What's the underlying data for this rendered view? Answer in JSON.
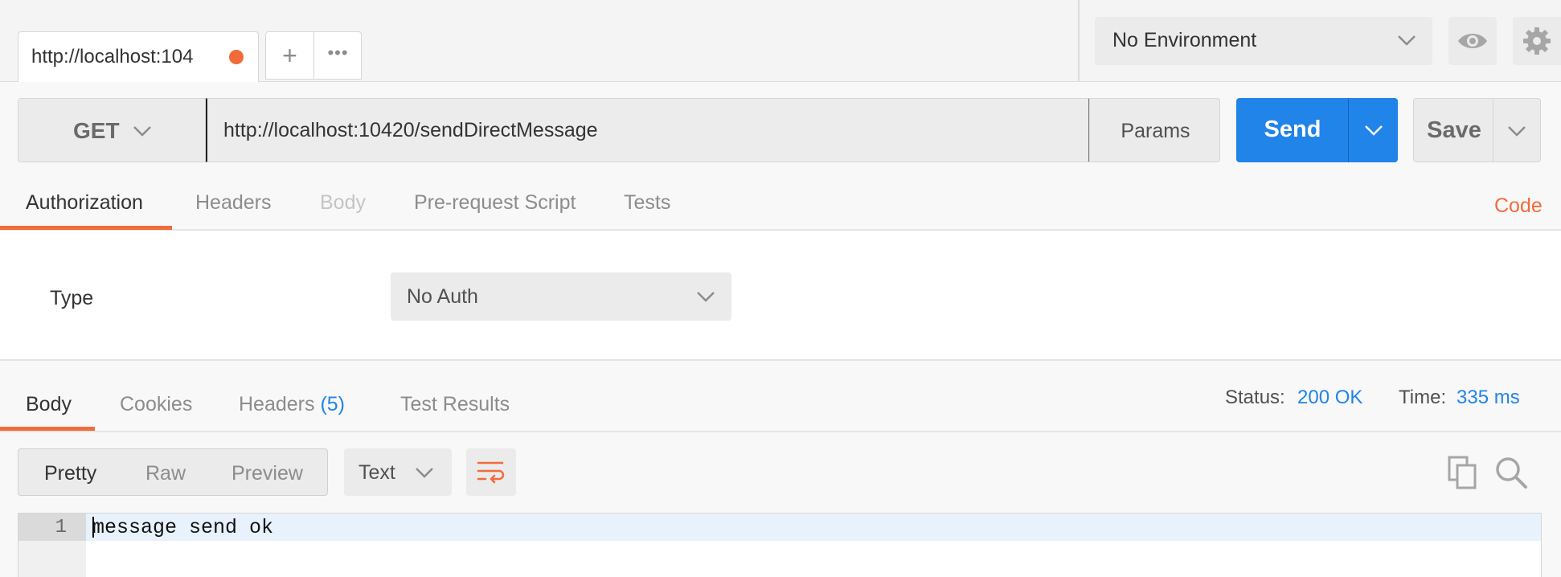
{
  "request_tab": {
    "label": "http://localhost:104",
    "unsaved_color": "#f26b3a"
  },
  "tab_actions": {
    "new_tab": "+",
    "more": "•••"
  },
  "environment": {
    "selected": "No Environment"
  },
  "request": {
    "method": "GET",
    "url": "http://localhost:10420/sendDirectMessage",
    "params_label": "Params",
    "send_label": "Send",
    "save_label": "Save"
  },
  "request_tabs": {
    "authorization": "Authorization",
    "headers": "Headers",
    "body": "Body",
    "pre_request": "Pre-request Script",
    "tests": "Tests",
    "code": "Code"
  },
  "auth": {
    "type_label": "Type",
    "type_value": "No Auth"
  },
  "response_tabs": {
    "body": "Body",
    "cookies": "Cookies",
    "headers": "Headers",
    "headers_count": "(5)",
    "test_results": "Test Results"
  },
  "response_meta": {
    "status_label": "Status:",
    "status_value": "200 OK",
    "time_label": "Time:",
    "time_value": "335 ms"
  },
  "response_view": {
    "pretty": "Pretty",
    "raw": "Raw",
    "preview": "Preview",
    "format": "Text"
  },
  "response_body": {
    "line_number": "1",
    "text": "message send ok"
  },
  "colors": {
    "accent": "#f26b3a",
    "primary": "#2184e8"
  },
  "icons": [
    "plus-icon",
    "more-icon",
    "chevron-down-icon",
    "eye-icon",
    "gear-icon",
    "wrap-icon",
    "copy-icon",
    "search-icon"
  ]
}
